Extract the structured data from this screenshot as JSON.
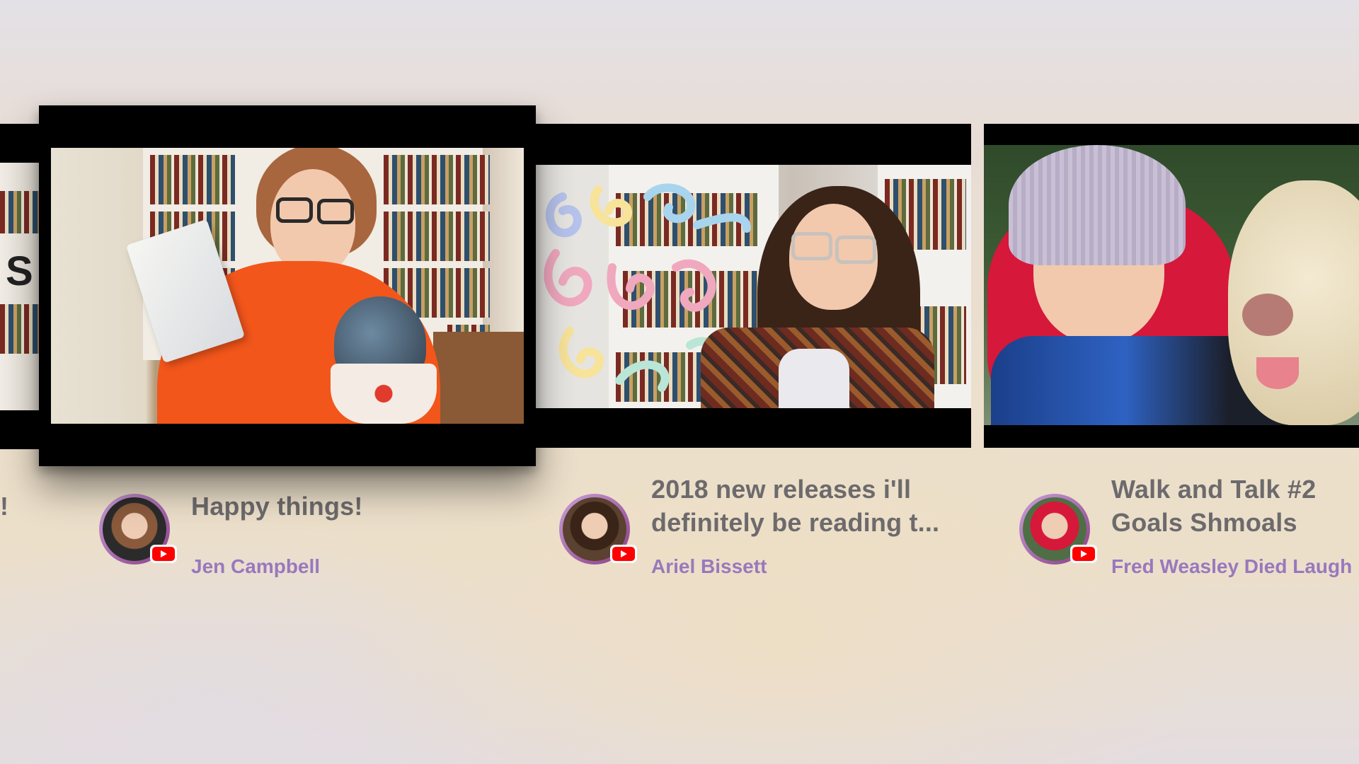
{
  "shelf": {
    "partial_left": {
      "title_fragment": "!",
      "thumbnail_text": "S"
    },
    "videos": [
      {
        "title_line1": "Happy things!",
        "title_line2": "",
        "channel": "Jen Campbell",
        "focused": true,
        "source_icon": "youtube-icon"
      },
      {
        "title_line1": "2018 new releases i'll",
        "title_line2": "definitely be reading t...",
        "channel": "Ariel Bissett",
        "focused": false,
        "source_icon": "youtube-icon"
      },
      {
        "title_line1": "Walk and Talk #2",
        "title_line2": "Goals Shmoals",
        "channel": "Fred Weasley Died Laugh",
        "focused": false,
        "source_icon": "youtube-icon"
      }
    ]
  },
  "colors": {
    "title_text": "#6c6a6c",
    "channel_text": "#9978bd",
    "youtube_red": "#ff0000"
  }
}
